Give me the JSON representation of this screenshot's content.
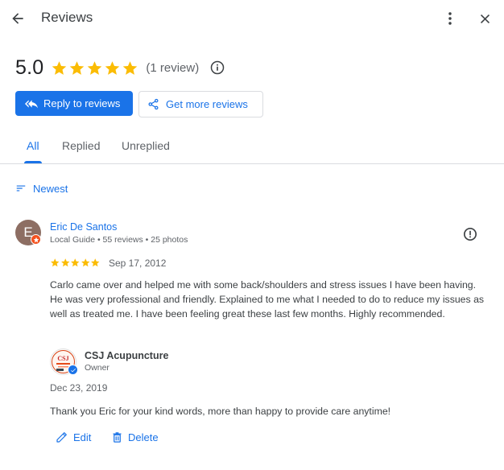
{
  "header": {
    "title": "Reviews"
  },
  "summary": {
    "rating": "5.0",
    "stars": 5,
    "review_count": "(1 review)"
  },
  "buttons": {
    "reply_label": "Reply to reviews",
    "get_more_label": "Get more reviews"
  },
  "tabs": [
    {
      "label": "All",
      "active": true
    },
    {
      "label": "Replied",
      "active": false
    },
    {
      "label": "Unreplied",
      "active": false
    }
  ],
  "sort": {
    "label": "Newest"
  },
  "review": {
    "avatar_letter": "E",
    "reviewer_name": "Eric De Santos",
    "reviewer_meta": "Local Guide • 55 reviews • 25 photos",
    "stars": 5,
    "date": "Sep 17, 2012",
    "text": "Carlo came over and helped me with some back/shoulders and stress issues I have been having. He was very professional and friendly. Explained to me what I needed to do to reduce my issues as well as treated me. I have been feeling great these last few months. Highly recommended."
  },
  "reply": {
    "owner_name": "CSJ Acupuncture",
    "owner_role": "Owner",
    "logo_text": "CSJ",
    "date": "Dec 23, 2019",
    "text": "Thank you Eric for your kind words, more than happy to provide care anytime!"
  },
  "actions": {
    "edit_label": "Edit",
    "delete_label": "Delete"
  },
  "colors": {
    "accent": "#1a73e8",
    "star": "#fbbc04",
    "avatar": "#8d6e63",
    "local_guide_badge": "#f4511e"
  },
  "icons": {
    "back": "arrow-back-icon",
    "more": "more-vert-icon",
    "close": "close-icon",
    "info": "info-icon",
    "reply": "reply-all-icon",
    "share": "share-icon",
    "sort": "sort-icon",
    "flag": "report-icon",
    "edit": "pencil-icon",
    "delete": "trash-icon"
  }
}
